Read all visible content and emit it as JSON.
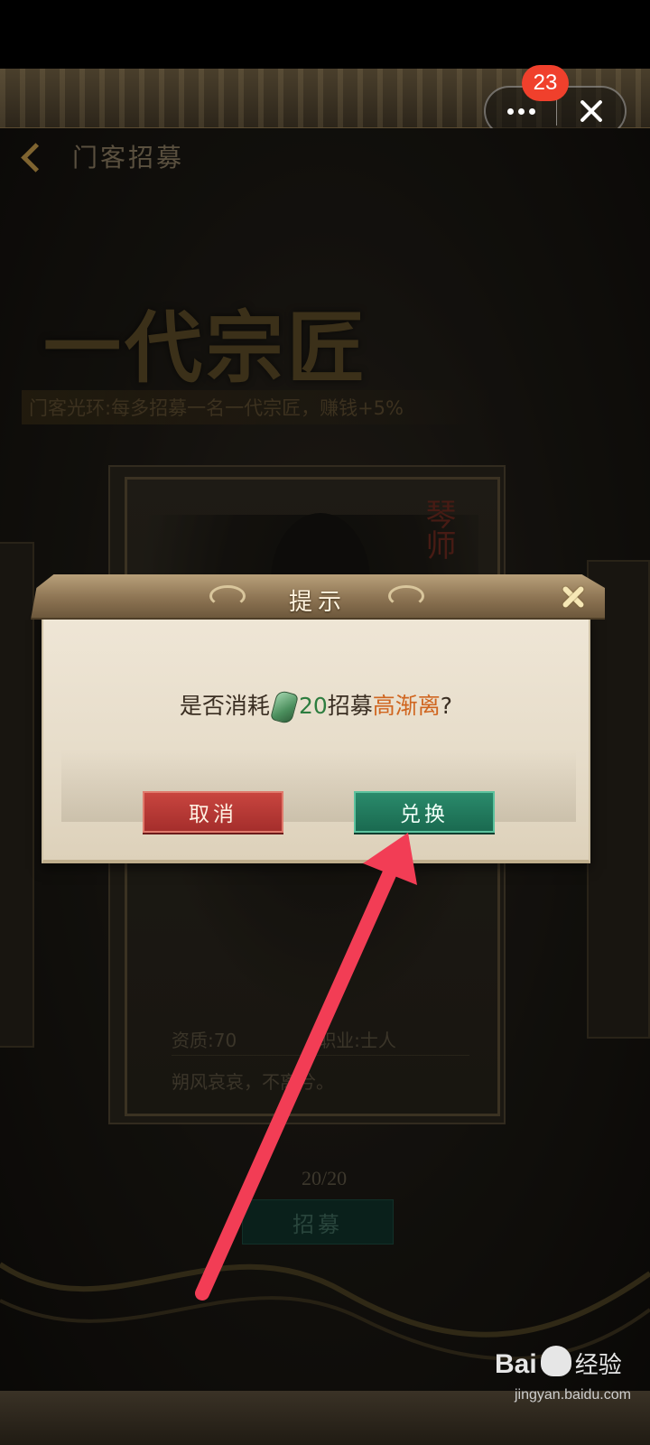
{
  "miniprogram": {
    "badge_count": "23"
  },
  "nav": {
    "title": "门客招募"
  },
  "banner": {
    "tier_title": "一代宗匠",
    "aura_text": "门客光环:每多招募一名一代宗匠，赚钱+5%"
  },
  "card": {
    "role": "琴师",
    "stat_aptitude": "资质:70",
    "stat_profession": "职业:士人",
    "quote": "朔风哀哀，不离兮。"
  },
  "recruit": {
    "count": "20/20",
    "button_label": "招募"
  },
  "dialog": {
    "title": "提示",
    "prompt_prefix": "是否消耗",
    "prompt_amount": "20",
    "prompt_action": "招募",
    "prompt_name": "高渐离",
    "prompt_suffix": "?",
    "cancel_label": "取消",
    "confirm_label": "兑换"
  },
  "annotation": {
    "arrow_color": "#f23d55"
  },
  "watermark": {
    "logo": "Bai",
    "suffix": "经验",
    "url": "jingyan.baidu.com"
  }
}
